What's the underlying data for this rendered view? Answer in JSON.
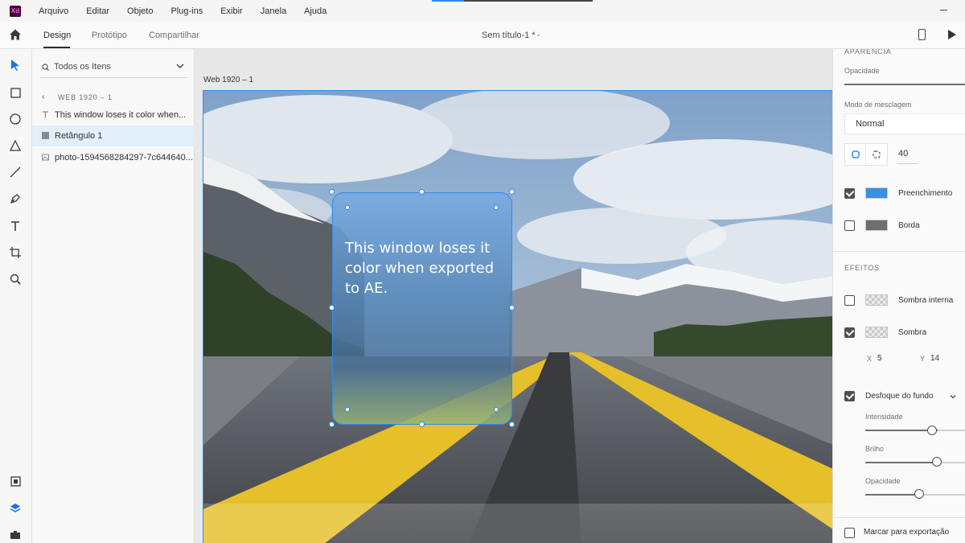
{
  "menubar": {
    "logo": "Xd",
    "items": [
      "Arquivo",
      "Editar",
      "Objeto",
      "Plug-ins",
      "Exibir",
      "Janela",
      "Ajuda"
    ]
  },
  "tabs": {
    "items": [
      "Design",
      "Protótipo",
      "Compartilhar"
    ],
    "active": "Design",
    "document_title": "Sem título-1 *"
  },
  "toolbar": {
    "tools": [
      "select-tool",
      "rectangle-tool",
      "ellipse-tool",
      "polygon-tool",
      "line-tool",
      "pen-tool",
      "text-tool",
      "artboard-tool",
      "zoom-tool"
    ],
    "bottom": [
      "assets-icon",
      "layers-icon",
      "plugins-icon"
    ]
  },
  "layers": {
    "search_label": "Todos os Itens",
    "artboard_crumb": "WEB 1920 – 1",
    "items": [
      {
        "icon": "text-icon",
        "label": "This window loses it color when..."
      },
      {
        "icon": "rectangle-icon",
        "label": "Retângulo 1",
        "selected": true
      },
      {
        "icon": "image-icon",
        "label": "photo-1594568284297-7c644640..."
      }
    ]
  },
  "canvas": {
    "artboard_title": "Web 1920 – 1",
    "glass_text": "This window loses it color when exported to AE."
  },
  "props": {
    "appearance_title": "APARÊNCIA",
    "opacity_label": "Opacidade",
    "blend_label": "Modo de mesclagem",
    "blend_value": "Normal",
    "corner_radius": "40",
    "fill_label": "Preenchimento",
    "fill_color": "#3b8fe0",
    "fill_checked": true,
    "border_label": "Borda",
    "border_color": "#6e6e6e",
    "border_checked": false,
    "effects_title": "EFEITOS",
    "inner_shadow_label": "Sombra interna",
    "inner_shadow_checked": false,
    "shadow_label": "Sombra",
    "shadow_checked": true,
    "shadow_x_label": "X",
    "shadow_x": "5",
    "shadow_y_label": "Y",
    "shadow_y": "14",
    "bg_blur_label": "Desfoque do fundo",
    "bg_blur_checked": true,
    "intensity_label": "Intensidade",
    "brightness_label": "Brilho",
    "blur_opacity_label": "Opacidade",
    "export_label": "Marcar para exportação",
    "export_checked": false
  }
}
